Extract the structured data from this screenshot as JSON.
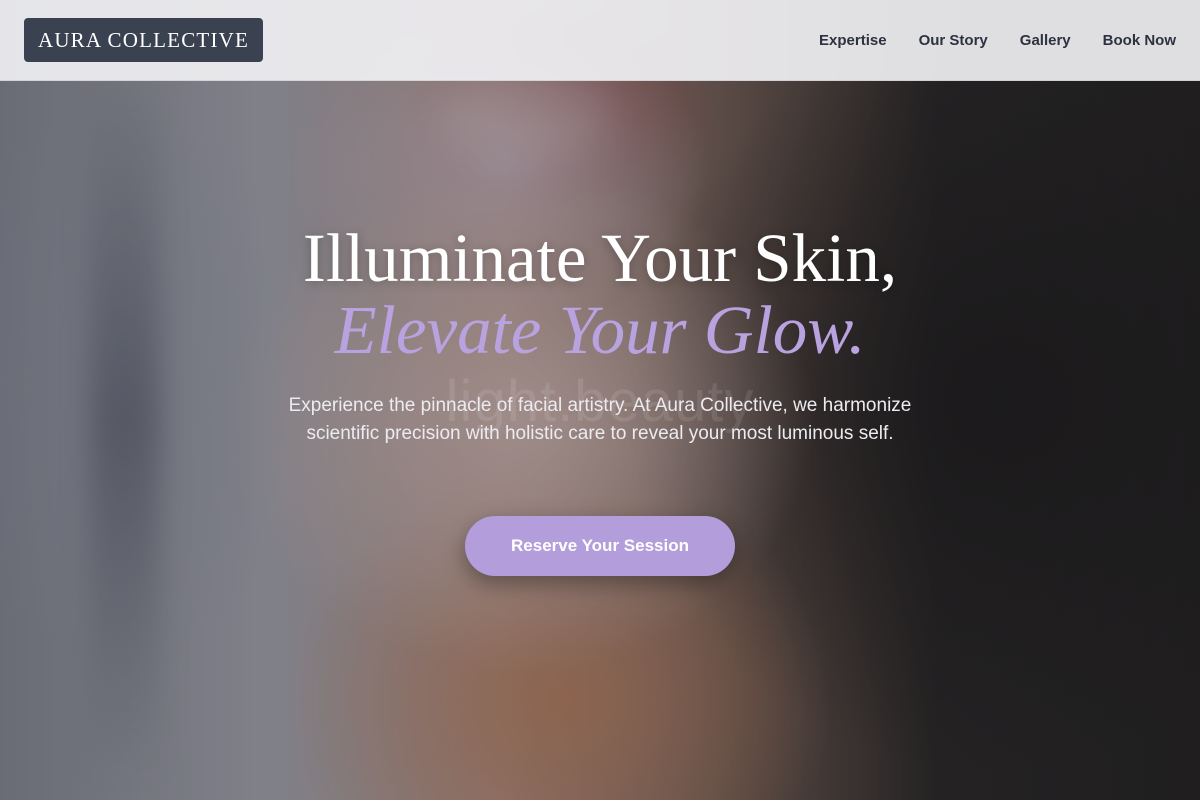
{
  "header": {
    "logo_text": "AURA COLLECTIVE",
    "nav": [
      {
        "label": "Expertise"
      },
      {
        "label": "Our Story"
      },
      {
        "label": "Gallery"
      },
      {
        "label": "Book Now"
      }
    ]
  },
  "hero": {
    "headline_line1": "Illuminate Your Skin,",
    "headline_line2": "Elevate Your Glow.",
    "watermark": "light.beauty",
    "subtext": "Experience the pinnacle of facial artistry. At Aura Collective, we harmonize scientific precision with holistic care to reveal your most luminous self.",
    "cta_label": "Reserve Your Session"
  },
  "colors": {
    "logo_bg": "#3a4150",
    "accent": "#b39ddb",
    "accent_text": "#b9a2e0",
    "nav_text": "#2d3240"
  }
}
